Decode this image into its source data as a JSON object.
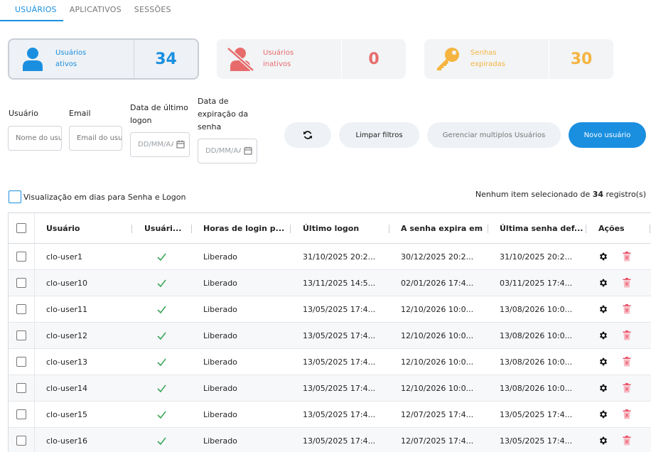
{
  "tabs": [
    "USUÁRIOS",
    "APLICATIVOS",
    "SESSÕES"
  ],
  "cards": {
    "active": {
      "label_line1": "Usuários",
      "label_line2": "ativos",
      "count": "34"
    },
    "inactive": {
      "label_line1": "Usuários",
      "label_line2": "inativos",
      "count": "0"
    },
    "expired": {
      "label_line1": "Senhas",
      "label_line2": "expiradas",
      "count": "30"
    }
  },
  "filters": {
    "user": {
      "label": "Usuário",
      "placeholder": "Nome do usuário"
    },
    "email": {
      "label": "Email",
      "placeholder": "Email do usuário"
    },
    "last_logon": {
      "label_line1": "Data de último",
      "label_line2": "logon",
      "placeholder": "DD/MM/AAAA"
    },
    "expiration": {
      "label_line1": "Data de",
      "label_line2": "expiração da",
      "label_line3": "senha",
      "placeholder": "DD/MM/AAAA"
    }
  },
  "buttons": {
    "clear": "Limpar filtros",
    "manage_multiple": "Gerenciar multiplos Usuários",
    "new_user": "Novo usuário"
  },
  "toggle_label": "Visualização em dias para Senha e Logon",
  "selection": {
    "prefix": "Nenhum item selecionado de",
    "total": "34",
    "suffix": "registro(s)"
  },
  "table": {
    "headers": [
      "Usuário",
      "Usuári...",
      "Horas de login p...",
      "Último logon",
      "A senha expira em",
      "Última senha def...",
      "Ações"
    ],
    "rows": [
      {
        "user": "clo-user1",
        "hours": "Liberado",
        "last_logon": "31/10/2025 20:2...",
        "expires": "30/12/2025 20:2...",
        "last_pwd": "31/10/2025 20:2..."
      },
      {
        "user": "clo-user10",
        "hours": "Liberado",
        "last_logon": "13/11/2025 14:5...",
        "expires": "02/01/2026 17:4...",
        "last_pwd": "03/11/2025 17:4..."
      },
      {
        "user": "clo-user11",
        "hours": "Liberado",
        "last_logon": "13/05/2025 17:4...",
        "expires": "12/10/2026 10:0...",
        "last_pwd": "13/08/2026 10:0..."
      },
      {
        "user": "clo-user12",
        "hours": "Liberado",
        "last_logon": "13/05/2025 17:4...",
        "expires": "12/10/2026 10:0...",
        "last_pwd": "13/08/2026 10:0..."
      },
      {
        "user": "clo-user13",
        "hours": "Liberado",
        "last_logon": "13/05/2025 17:4...",
        "expires": "12/10/2026 10:0...",
        "last_pwd": "13/08/2026 10:0..."
      },
      {
        "user": "clo-user14",
        "hours": "Liberado",
        "last_logon": "13/05/2025 17:4...",
        "expires": "12/10/2026 10:0...",
        "last_pwd": "13/08/2026 10:0..."
      },
      {
        "user": "clo-user15",
        "hours": "Liberado",
        "last_logon": "13/05/2025 17:4...",
        "expires": "12/07/2025 17:4...",
        "last_pwd": "13/05/2025 17:4..."
      },
      {
        "user": "clo-user16",
        "hours": "Liberado",
        "last_logon": "13/05/2025 17:4...",
        "expires": "12/07/2025 17:4...",
        "last_pwd": "13/05/2025 17:4..."
      }
    ]
  },
  "colors": {
    "accent": "#1a8fe0",
    "danger": "#e86b6b",
    "warning": "#f5b440",
    "success": "#3ca65a"
  }
}
